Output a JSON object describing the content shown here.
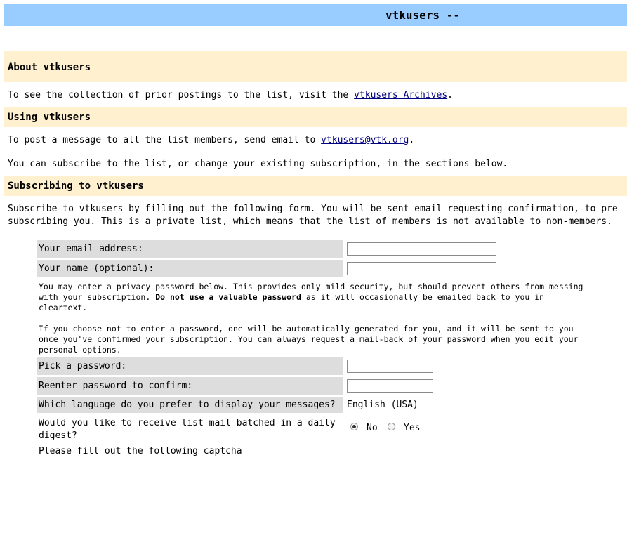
{
  "header": {
    "title": "vtkusers --"
  },
  "about": {
    "heading": "About vtkusers",
    "text_before": "To see the collection of prior postings to the list, visit the",
    "archives_link": "vtkusers Archives",
    "text_after": "."
  },
  "using": {
    "heading": "Using vtkusers",
    "post_text_before": "To post a message to all the list members, send email to",
    "email_link": "vtkusers@vtk.org",
    "post_text_after": ".",
    "subscribe_text": "You can subscribe to the list, or change your existing subscription, in the sections below."
  },
  "subscribing": {
    "heading": "Subscribing to vtkusers",
    "intro_line1": "Subscribe to vtkusers by filling out the following form. You will be sent email requesting confirmation, to pre",
    "intro_line2": "subscribing you. This is a private list, which means that the list of members is not available to non-members."
  },
  "form": {
    "email_label": "Your email address:",
    "email_value": "",
    "name_label": "Your name (optional):",
    "name_value": "",
    "privacy_line1": "You may enter a privacy password below. This provides only mild security, but should prevent others from messing",
    "privacy_line2_before": "with your subscription.",
    "privacy_line2_bold": "Do not use a valuable password",
    "privacy_line2_after": "as it will occasionally be emailed back to you in",
    "privacy_line3": "cleartext.",
    "auto_line1": "If you choose not to enter a password, one will be automatically generated for you, and it will be sent to you",
    "auto_line2": "once you've confirmed your subscription. You can always request a mail-back of your password when you edit your",
    "auto_line3": "personal options.",
    "password_label": "Pick a password:",
    "password_value": "",
    "confirm_label": "Reenter password to confirm:",
    "confirm_value": "",
    "language_label": "Which language do you prefer to display your messages?",
    "language_value": "English (USA)",
    "digest_label_line1": "Would you like to receive list mail batched in a daily",
    "digest_label_line2": "digest?",
    "digest_no": "No",
    "digest_yes": "Yes",
    "digest_selected": "No",
    "captcha_text": "Please fill out the following captcha"
  },
  "colors": {
    "topbar": "#99ccff",
    "section": "#fff0d0",
    "label_cell": "#dddddd",
    "link": "#000080"
  }
}
